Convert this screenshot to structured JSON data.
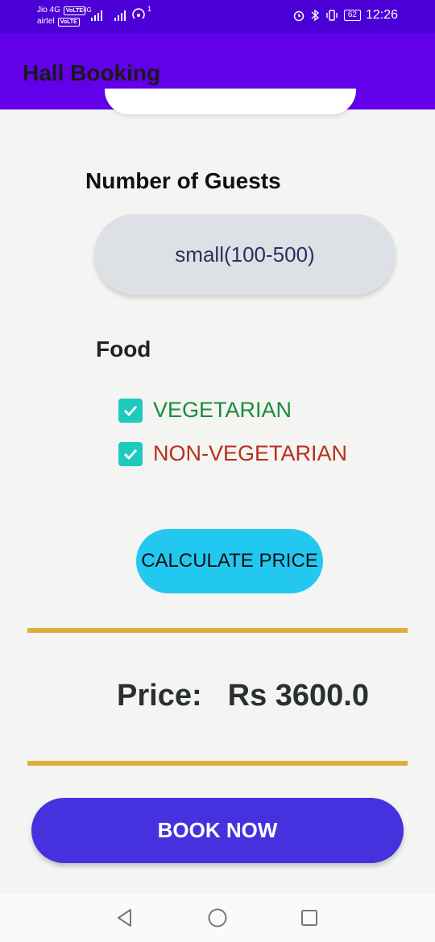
{
  "statusbar": {
    "carrier1": "Jio 4G",
    "carrier2": "airtel",
    "volte": "VoLTE",
    "net_type": "4G",
    "sim_sup": "1",
    "battery": "62",
    "time": "12:26"
  },
  "appbar": {
    "title": "Hall Booking"
  },
  "guests": {
    "label": "Number of Guests",
    "selected": "small(100-500)"
  },
  "food": {
    "label": "Food",
    "options": [
      {
        "label": "VEGETARIAN",
        "checked": true,
        "color": "#178d3a"
      },
      {
        "label": "NON-VEGETARIAN",
        "checked": true,
        "color": "#b5301c"
      }
    ]
  },
  "calculate": {
    "label": "CALCULATE PRICE"
  },
  "price": {
    "label": "Price:",
    "value": "Rs 3600.0"
  },
  "book": {
    "label": "BOOK NOW"
  },
  "colors": {
    "statusbar": "#4c00d6",
    "appbar": "#6200ea",
    "calc_button": "#22c8f0",
    "book_button": "#4532de",
    "divider": "#dcae3e",
    "checkbox": "#1ec9bd"
  },
  "navbar": {
    "icons": [
      "back-icon",
      "home-icon",
      "recents-icon"
    ]
  }
}
